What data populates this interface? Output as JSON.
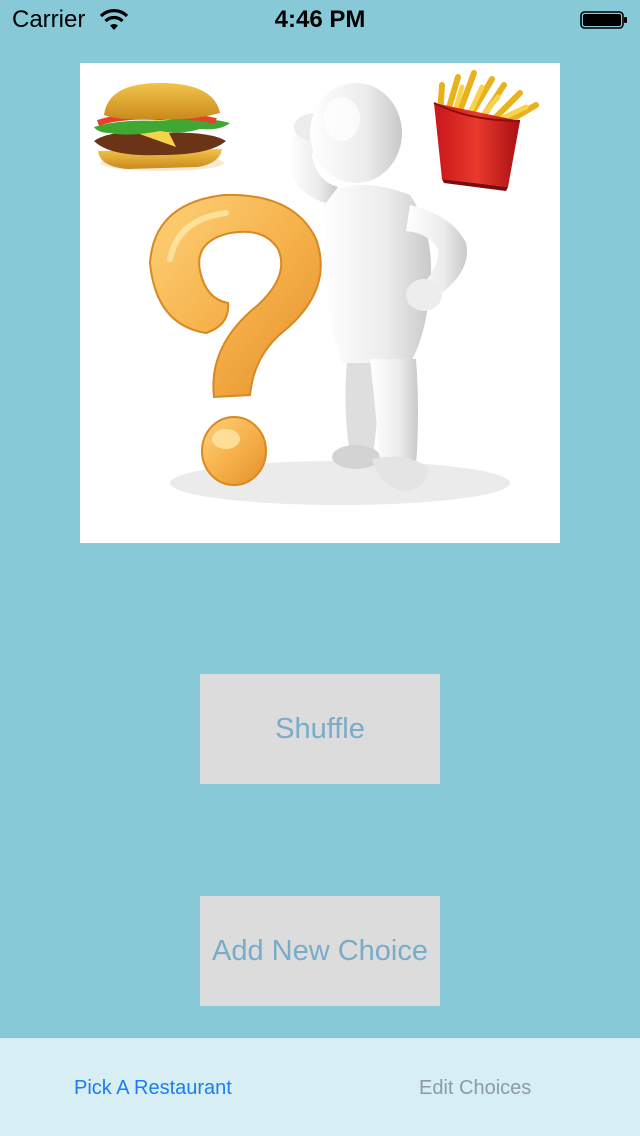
{
  "status_bar": {
    "carrier": "Carrier",
    "time": "4:46 PM",
    "wifi_icon": "wifi-icon",
    "battery_icon": "battery-icon"
  },
  "hero_image": {
    "elements": [
      "hamburger-icon",
      "french-fries-icon",
      "question-mark",
      "thinking-person"
    ]
  },
  "buttons": {
    "shuffle": "Shuffle",
    "add_new_choice": "Add New Choice"
  },
  "tab_bar": {
    "tabs": [
      {
        "label": "Pick A Restaurant",
        "selected": true
      },
      {
        "label": "Edit Choices",
        "selected": false
      }
    ]
  },
  "colors": {
    "background": "#88c9d8",
    "button_bg": "#dcdcdc",
    "button_text": "#79acc8",
    "tab_selected": "#1a7ef0",
    "tab_unselected": "#8e9aa2"
  }
}
